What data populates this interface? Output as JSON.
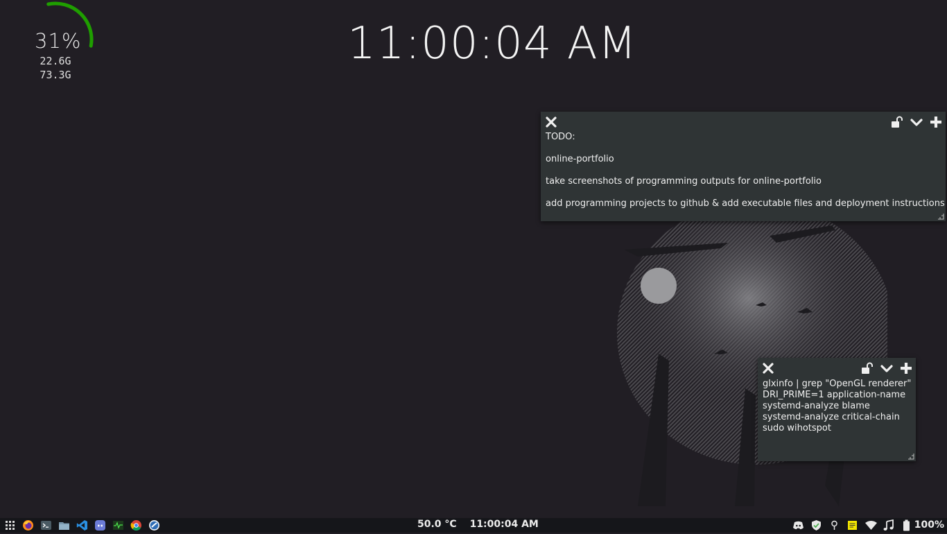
{
  "desktop": {
    "clock": "11:00:04 AM",
    "disk": {
      "percent": "31%",
      "used": "22.6G",
      "total": "73.3G",
      "usage_fraction": 0.31,
      "ring_color": "#1f9e00"
    }
  },
  "notes": [
    {
      "lines": [
        "TODO:",
        "online-portfolio",
        "take screenshots of programming outputs for online-portfolio",
        "add programming projects to github & add executable files and deployment instructions"
      ]
    },
    {
      "lines": [
        "glxinfo | grep \"OpenGL renderer\"",
        "DRI_PRIME=1 application-name",
        "systemd-analyze blame",
        "systemd-analyze critical-chain",
        "sudo wihotspot"
      ]
    }
  ],
  "taskbar": {
    "temperature": "50.0 °C",
    "clock": "11:00:04 AM",
    "battery": "100%",
    "launchers": [
      "apps-grid-icon",
      "firefox-icon",
      "terminal-icon",
      "files-icon",
      "vscode-icon",
      "discord-icon",
      "system-monitor-icon",
      "chrome-icon",
      "browser-icon"
    ],
    "tray": [
      "discord-tray-icon",
      "shield-icon",
      "location-icon",
      "notes-icon",
      "wifi-icon",
      "music-icon",
      "battery-icon"
    ]
  },
  "colors": {
    "desktop_bg": "#211e24",
    "note_bg": "#2f3435",
    "taskbar_bg": "#15161a"
  }
}
